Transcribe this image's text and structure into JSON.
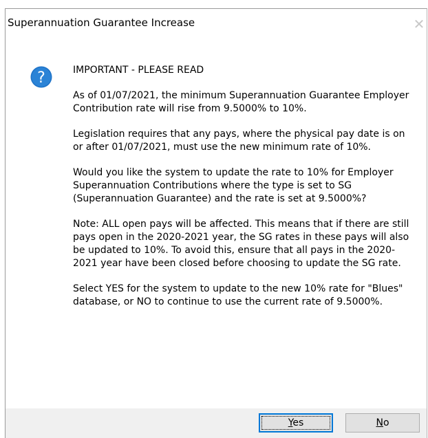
{
  "window": {
    "title": "Superannuation Guarantee Increase",
    "close_glyph": "✕"
  },
  "icon": {
    "name": "question-icon",
    "color": "#1e73c8"
  },
  "message": {
    "heading": "IMPORTANT - PLEASE READ",
    "paragraphs": [
      "As of 01/07/2021, the minimum Superannuation Guarantee Employer Contribution rate will rise from 9.5000% to 10%.",
      "Legislation requires that any pays, where the physical pay date is on or after 01/07/2021, must use the new minimum rate of 10%.",
      "Would you like the system to update the rate to 10% for Employer Superannuation Contributions where the type is set to SG (Superannuation Guarantee) and the rate is set at 9.5000%?",
      "Note: ALL open pays will be affected. This means that if there are still pays open in the 2020-2021 year, the SG rates in these pays will also be updated to 10%. To avoid this, ensure that all pays in the 2020-2021 year have been closed before choosing to update the SG rate.",
      "Select YES for the system to update to the new 10% rate for \"Blues\" database, or NO to continue to use the current rate of 9.5000%."
    ]
  },
  "buttons": {
    "yes": {
      "accel": "Y",
      "rest": "es"
    },
    "no": {
      "accel": "N",
      "rest": "o"
    }
  },
  "colors": {
    "accent": "#0078d7",
    "footer_bg": "#f0f0f0",
    "button_bg": "#e1e1e1"
  }
}
